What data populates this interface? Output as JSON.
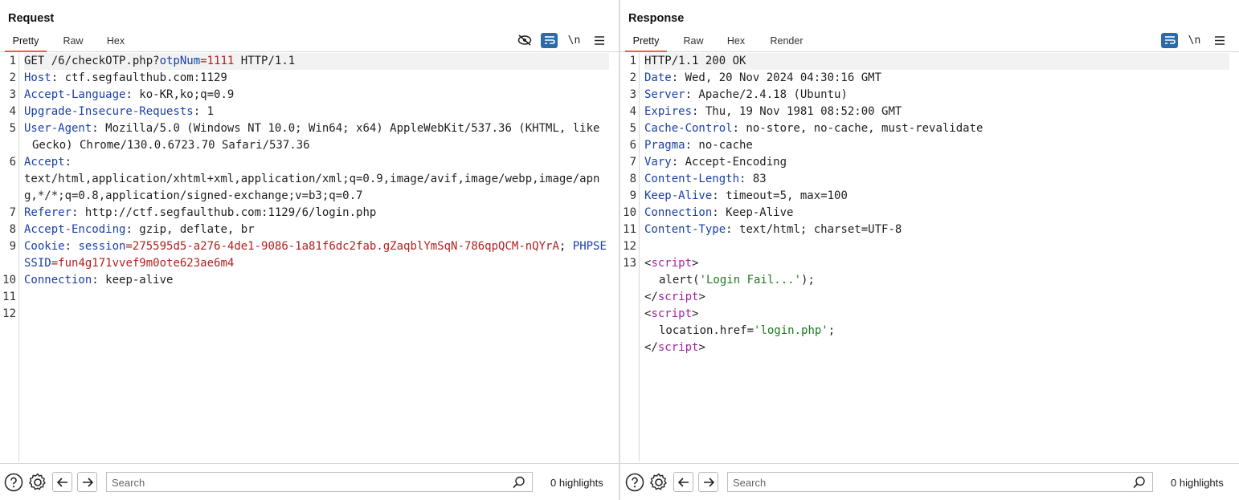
{
  "request": {
    "title": "Request",
    "tabs": [
      "Pretty",
      "Raw",
      "Hex"
    ],
    "active_tab": "Pretty",
    "lines": [
      {
        "n": "1"
      },
      {
        "n": "2"
      },
      {
        "n": "3"
      },
      {
        "n": "4"
      },
      {
        "n": "5"
      },
      {
        "n": "6"
      },
      {
        "n": "7"
      },
      {
        "n": "8"
      },
      {
        "n": "9"
      },
      {
        "n": "10"
      },
      {
        "n": "11"
      },
      {
        "n": "12"
      }
    ],
    "text": {
      "l1_method": "GET /6/checkOTP.php?",
      "l1_param": "otpNum",
      "l1_eq": "=",
      "l1_val": "1111",
      "l1_proto": " HTTP/1.1",
      "l2_key": "Host",
      "l2_val": ": ctf.segfaulthub.com:1129",
      "l3_key": "Accept-Language",
      "l3_val": ": ko-KR,ko;q=0.9",
      "l4_key": "Upgrade-Insecure-Requests",
      "l4_val": ": 1",
      "l5_key": "User-Agent",
      "l5_val": ": Mozilla/5.0 (Windows NT 10.0; Win64; x64) AppleWebKit/537.36 (KHTML, like Gecko) Chrome/130.0.6723.70 Safari/537.36",
      "l6_key": "Accept",
      "l6_val": ":",
      "l6_cont": "text/html,application/xhtml+xml,application/xml;q=0.9,image/avif,image/webp,image/apng,*/*;q=0.8,application/signed-exchange;v=b3;q=0.7",
      "l7_key": "Referer",
      "l7_val": ": http://ctf.segfaulthub.com:1129/6/login.php",
      "l8_key": "Accept-Encoding",
      "l8_val": ": gzip, deflate, br",
      "l9_key": "Cookie",
      "l9_sep": ": ",
      "l9_c1": "session",
      "l9_eq1": "=",
      "l9_v1": "275595d5-a276-4de1-9086-1a81f6dc2fab.gZaqblYmSqN-786qpQCM-nQYrA",
      "l9_semi": "; ",
      "l9_c2": "PHPSESSID",
      "l9_eq2": "=",
      "l9_v2": "fun4g171vvef9m0ote623ae6m4",
      "l10_key": "Connection",
      "l10_val": ": keep-alive"
    },
    "search": {
      "placeholder": "Search",
      "value": ""
    },
    "highlights": "0 highlights"
  },
  "response": {
    "title": "Response",
    "tabs": [
      "Pretty",
      "Raw",
      "Hex",
      "Render"
    ],
    "active_tab": "Pretty",
    "lines": [
      {
        "n": "1"
      },
      {
        "n": "2"
      },
      {
        "n": "3"
      },
      {
        "n": "4"
      },
      {
        "n": "5"
      },
      {
        "n": "6"
      },
      {
        "n": "7"
      },
      {
        "n": "8"
      },
      {
        "n": "9"
      },
      {
        "n": "10"
      },
      {
        "n": "11"
      },
      {
        "n": "12"
      },
      {
        "n": "13"
      }
    ],
    "text": {
      "l1": "HTTP/1.1 200 OK",
      "l2_key": "Date",
      "l2_val": ": Wed, 20 Nov 2024 04:30:16 GMT",
      "l3_key": "Server",
      "l3_val": ": Apache/2.4.18 (Ubuntu)",
      "l4_key": "Expires",
      "l4_val": ": Thu, 19 Nov 1981 08:52:00 GMT",
      "l5_key": "Cache-Control",
      "l5_val": ": no-store, no-cache, must-revalidate",
      "l6_key": "Pragma",
      "l6_val": ": no-cache",
      "l7_key": "Vary",
      "l7_val": ": Accept-Encoding",
      "l8_key": "Content-Length",
      "l8_val": ": 83",
      "l9_key": "Keep-Alive",
      "l9_val": ": timeout=5, max=100",
      "l10_key": "Connection",
      "l10_val": ": Keep-Alive",
      "l11_key": "Content-Type",
      "l11_val": ": text/html; charset=UTF-8",
      "lt": "<",
      "gt": ">",
      "close_lt": "</",
      "script": "script",
      "alert_fn": "alert(",
      "alert_str": "'Login Fail...'",
      "alert_end": ");",
      "loc_fn": "location.href=",
      "loc_str": "'login.php'",
      "loc_end": ";"
    },
    "search": {
      "placeholder": "Search",
      "value": ""
    },
    "highlights": "0 highlights"
  },
  "toolbar": {
    "newline_label": "\\n"
  },
  "colors": {
    "accent_tab": "#e8642c",
    "toggle_on": "#2c6aa8",
    "header_key": "#1a3fa8",
    "value_red": "#b02020",
    "tag_purple": "#a61fa6",
    "string_green": "#1e7a1e"
  }
}
